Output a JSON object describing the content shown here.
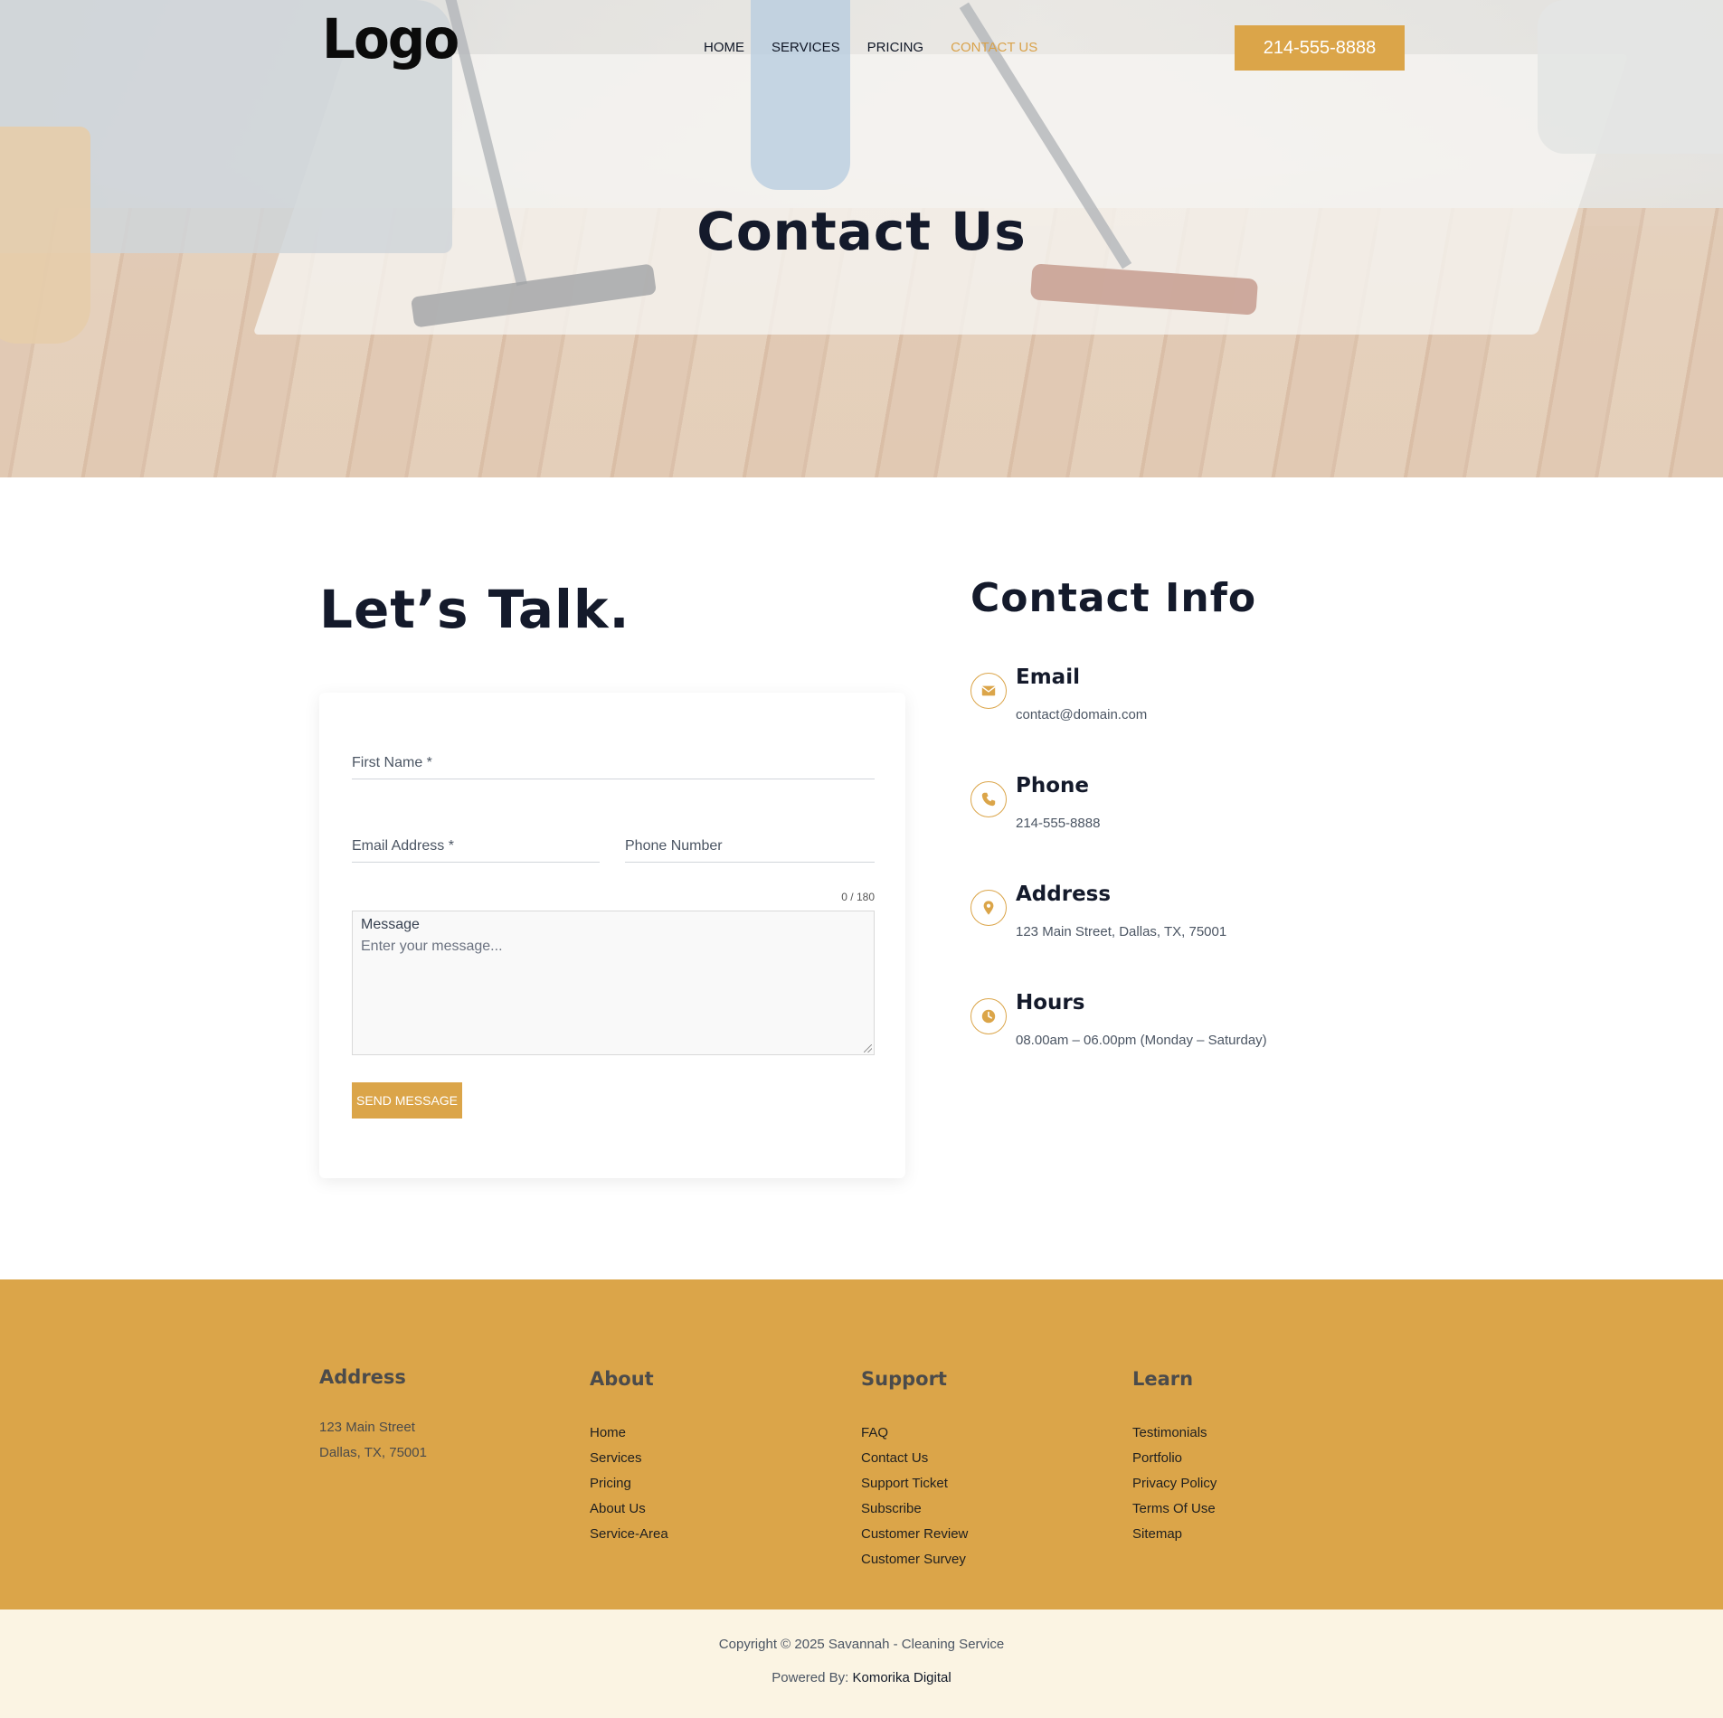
{
  "header": {
    "logo_text": "Logo",
    "nav": [
      {
        "label": "HOME",
        "active": false
      },
      {
        "label": "SERVICES",
        "active": false
      },
      {
        "label": "PRICING",
        "active": false
      },
      {
        "label": "CONTACT US",
        "active": true
      }
    ],
    "phone_button": "214-555-8888"
  },
  "hero": {
    "title": "Contact Us"
  },
  "form": {
    "heading": "Let’s Talk.",
    "first_name_label": "First Name *",
    "email_label": "Email Address *",
    "phone_label": "Phone Number",
    "counter": "0 / 180",
    "message_label": "Message",
    "message_placeholder": "Enter your message...",
    "send_button": "SEND MESSAGE"
  },
  "contact_info": {
    "title": "Contact Info",
    "email": {
      "heading": "Email",
      "value": "contact@domain.com",
      "icon": "envelope-icon"
    },
    "phone": {
      "heading": "Phone",
      "value": "214-555-8888",
      "icon": "phone-icon"
    },
    "address": {
      "heading": "Address",
      "value": "123 Main Street, Dallas, TX, 75001",
      "icon": "map-pin-icon"
    },
    "hours": {
      "heading": "Hours",
      "value": "08.00am – 06.00pm (Monday – Saturday)",
      "icon": "clock-icon"
    }
  },
  "footer": {
    "address": {
      "heading": "Address",
      "line1": "123 Main Street",
      "line2": "Dallas, TX, 75001"
    },
    "about": {
      "heading": "About",
      "links": [
        "Home",
        "Services",
        "Pricing",
        "About Us",
        "Service-Area"
      ]
    },
    "support": {
      "heading": "Support",
      "links": [
        "FAQ",
        "Contact Us",
        "Support Ticket",
        "Subscribe",
        "Customer Review",
        "Customer Survey"
      ]
    },
    "learn": {
      "heading": "Learn",
      "links": [
        "Testimonials",
        "Portfolio",
        "Privacy Policy",
        "Terms Of Use",
        "Sitemap"
      ]
    }
  },
  "bottom": {
    "copyright": "Copyright © 2025 Savannah - Cleaning Service",
    "powered_prefix": "Powered By: ",
    "powered_link": "Komorika Digital"
  },
  "colors": {
    "accent": "#dba549",
    "heading": "#141a2b",
    "bottom_bar": "#fbf4e3"
  }
}
